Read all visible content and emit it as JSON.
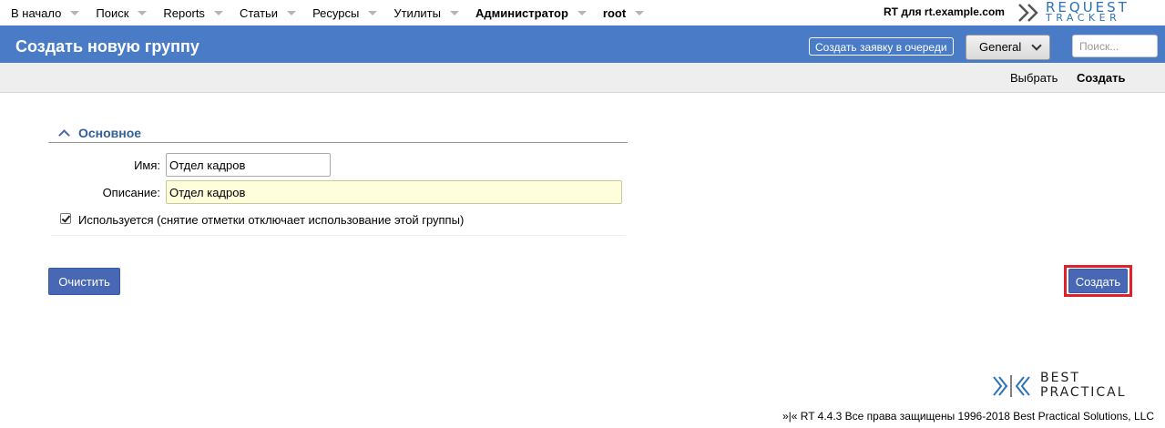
{
  "top_menu": {
    "items": [
      {
        "label": "В начало",
        "bold": false
      },
      {
        "label": "Поиск",
        "bold": false
      },
      {
        "label": "Reports",
        "bold": false
      },
      {
        "label": "Статьи",
        "bold": false
      },
      {
        "label": "Ресурсы",
        "bold": false
      },
      {
        "label": "Утилиты",
        "bold": false
      },
      {
        "label": "Администратор",
        "bold": true
      },
      {
        "label": "root",
        "bold": true
      }
    ],
    "site_name": "RT для rt.example.com",
    "logo_line1": "REQUEST",
    "logo_line2": "TRACKER"
  },
  "header": {
    "title": "Создать новую группу",
    "create_ticket_label": "Создать заявку в очереди",
    "queue_selected": "General",
    "search_placeholder": "Поиск..."
  },
  "page_menu": {
    "select_label": "Выбрать",
    "create_label": "Создать"
  },
  "form": {
    "section_title": "Основное",
    "name_label": "Имя:",
    "name_value": "Отдел кадров",
    "description_label": "Описание:",
    "description_value": "Отдел кадров",
    "enabled_checked": true,
    "enabled_label": "Используется (снятие отметки отключает использование этой группы)",
    "reset_button": "Очистить",
    "create_button": "Создать"
  },
  "footer": {
    "logo_line1": "BEST",
    "logo_line2": "PRACTICAL",
    "copyright": "»|« RT 4.4.3 Все права защищены 1996-2018 Best Practical Solutions, LLC"
  },
  "colors": {
    "header_blue": "#4a7bc7",
    "button_blue": "#4868b6",
    "highlight_red": "#e0212b",
    "section_title": "#31609a"
  }
}
